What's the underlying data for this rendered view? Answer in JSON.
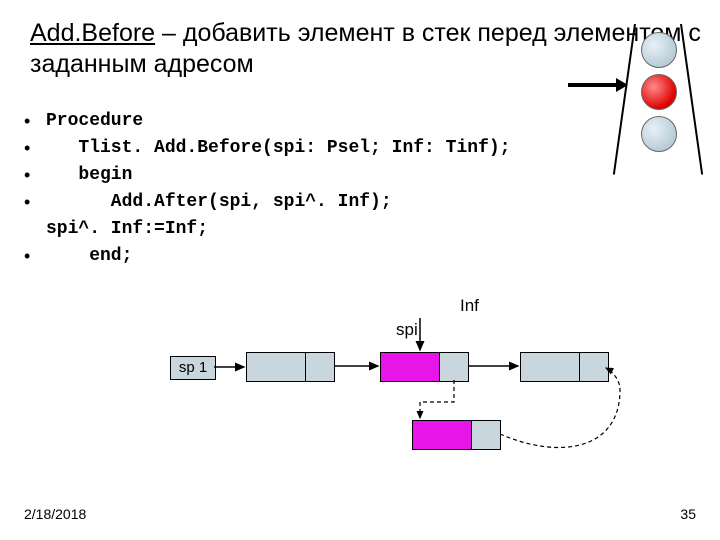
{
  "title": {
    "underlined": "Add.Before",
    "rest": " – добавить элемент в стек перед элементом с заданным адресом"
  },
  "code": {
    "l1": "Procedure",
    "l2": "   Tlist. Add.Before(spi: Psel; Inf: Tinf);",
    "l3": "   begin",
    "l4": "      Add.After(spi, spi^. Inf);",
    "l4b": "spi^. Inf:=Inf;",
    "l5": "    end;"
  },
  "labels": {
    "inf": "Inf",
    "spi": "spi",
    "sp1": "sp 1"
  },
  "footer": {
    "date": "2/18/2018",
    "page": "35"
  }
}
